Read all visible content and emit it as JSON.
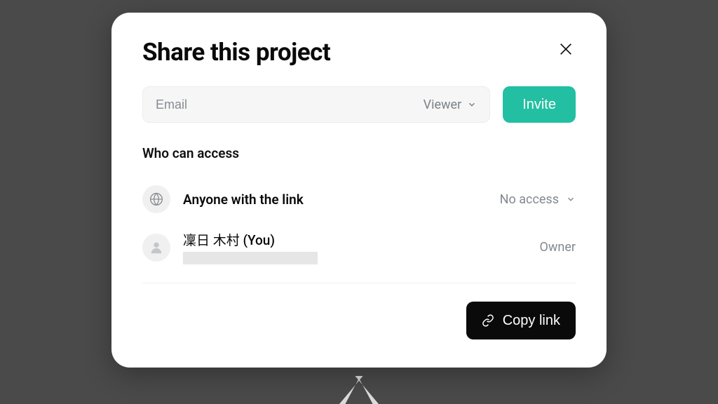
{
  "modal": {
    "title": "Share this project",
    "email_placeholder": "Email",
    "role_label": "Viewer",
    "invite_label": "Invite",
    "section_heading": "Who can access",
    "link_row": {
      "label": "Anyone with the link",
      "permission": "No access"
    },
    "user_row": {
      "name": "凜日 木村 (You)",
      "role": "Owner"
    },
    "copy_link_label": "Copy link"
  }
}
